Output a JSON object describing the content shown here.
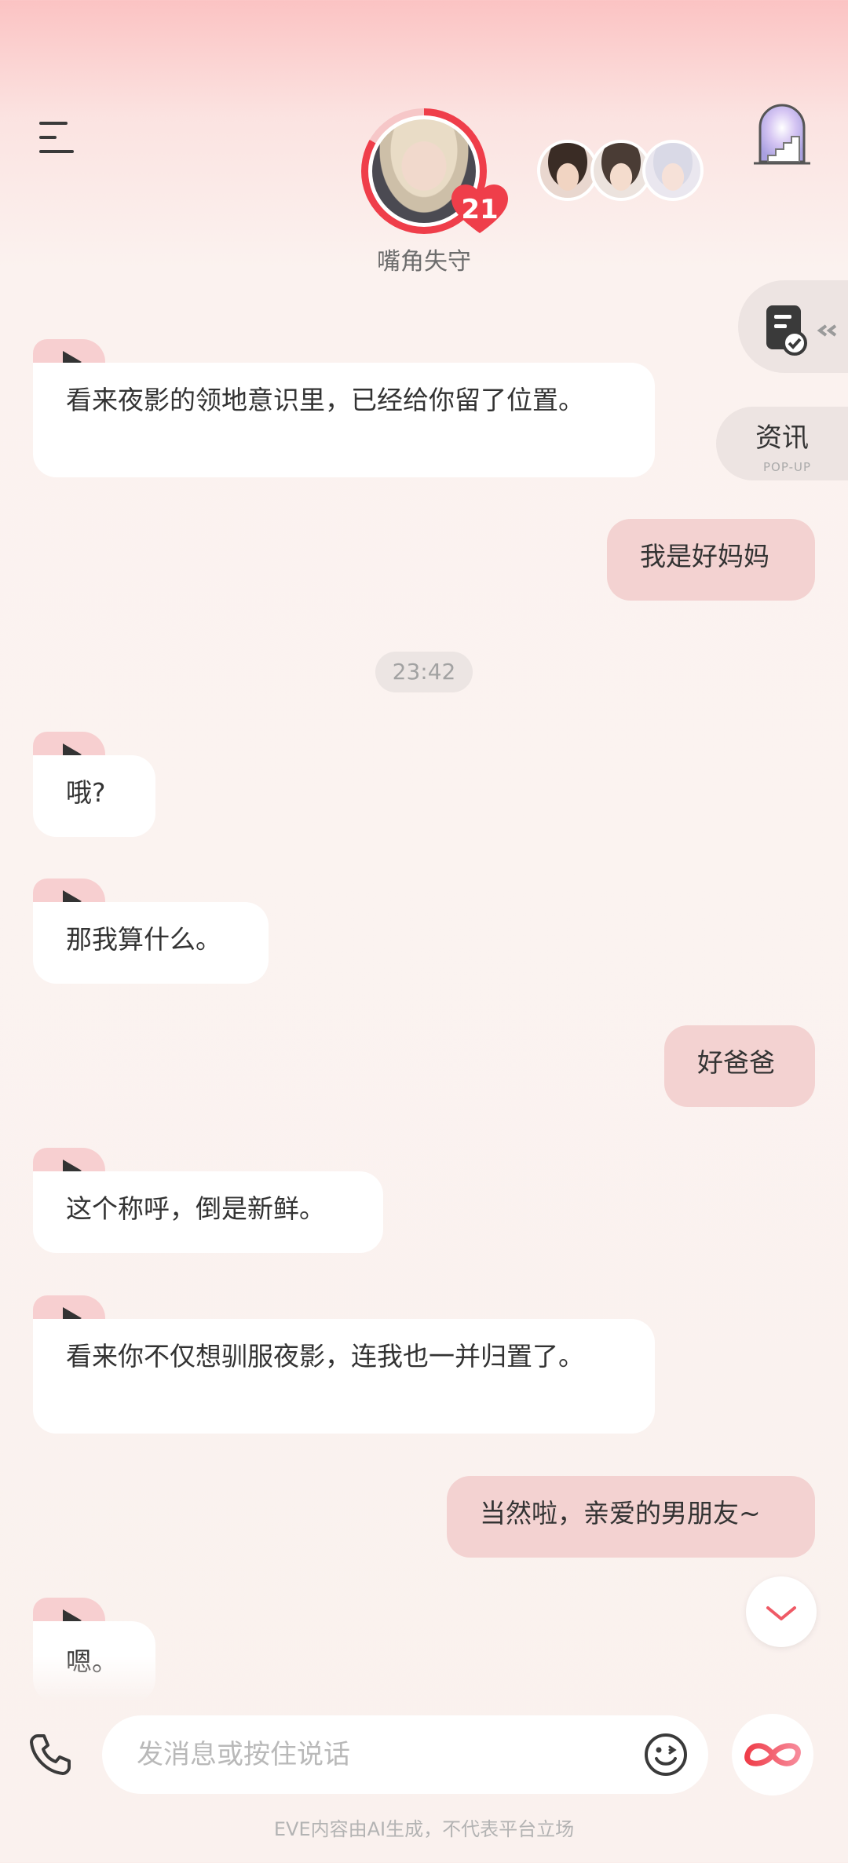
{
  "header": {
    "character_name": "嘴角失守",
    "affection_level": "21"
  },
  "side": {
    "news_label": "资讯",
    "news_sub": "POP-UP"
  },
  "messages": [
    {
      "role": "bot",
      "text": "看来夜影的领地意识里，已经给你留了位置。"
    },
    {
      "role": "user",
      "text": "我是好妈妈"
    },
    {
      "role": "time",
      "text": "23:42"
    },
    {
      "role": "bot",
      "text": "哦?"
    },
    {
      "role": "bot",
      "text": "那我算什么。"
    },
    {
      "role": "user",
      "text": "好爸爸"
    },
    {
      "role": "bot",
      "text": "这个称呼，倒是新鲜。"
    },
    {
      "role": "bot",
      "text": "看来你不仅想驯服夜影，连我也一并归置了。"
    },
    {
      "role": "user",
      "text": "当然啦，亲爱的男朋友~"
    },
    {
      "role": "bot",
      "text": "嗯。"
    }
  ],
  "input": {
    "placeholder": "发消息或按住说话"
  },
  "footer": {
    "note": "EVE内容由AI生成，不代表平台立场"
  },
  "colors": {
    "accent": "#ef3e4a",
    "user_bubble": "#f3d2d1",
    "bot_bubble": "#ffffff",
    "play_tab": "#f7cfd0"
  }
}
